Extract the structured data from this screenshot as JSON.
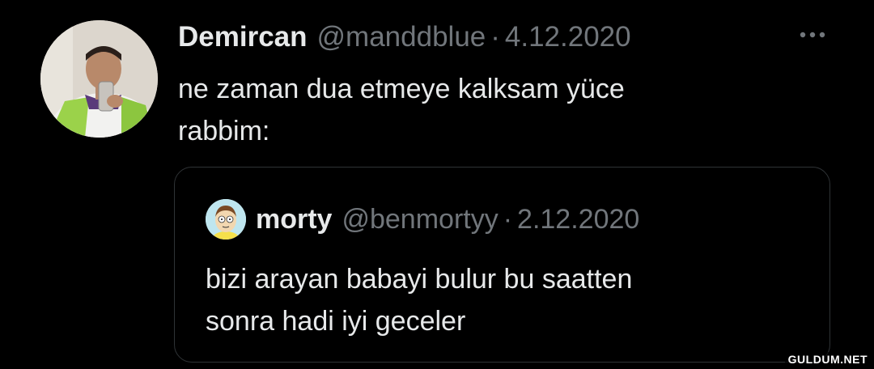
{
  "tweet": {
    "author_name": "Demircan",
    "author_handle": "@manddblue",
    "separator": "·",
    "date": "4.12.2020",
    "text": "ne zaman dua etmeye kalksam yüce\nrabbim:",
    "more_icon": "more-horizontal-icon"
  },
  "quoted_tweet": {
    "author_name": "morty",
    "author_handle": "@benmortyy",
    "separator": "·",
    "date": "2.12.2020",
    "text": "bizi arayan babayi bulur bu saatten\nsonra hadi iyi geceler"
  },
  "watermark": "GULDUM.NET",
  "colors": {
    "background": "#000000",
    "primary_text": "#e7e9ea",
    "secondary_text": "#71767b",
    "border": "#2f3336"
  }
}
